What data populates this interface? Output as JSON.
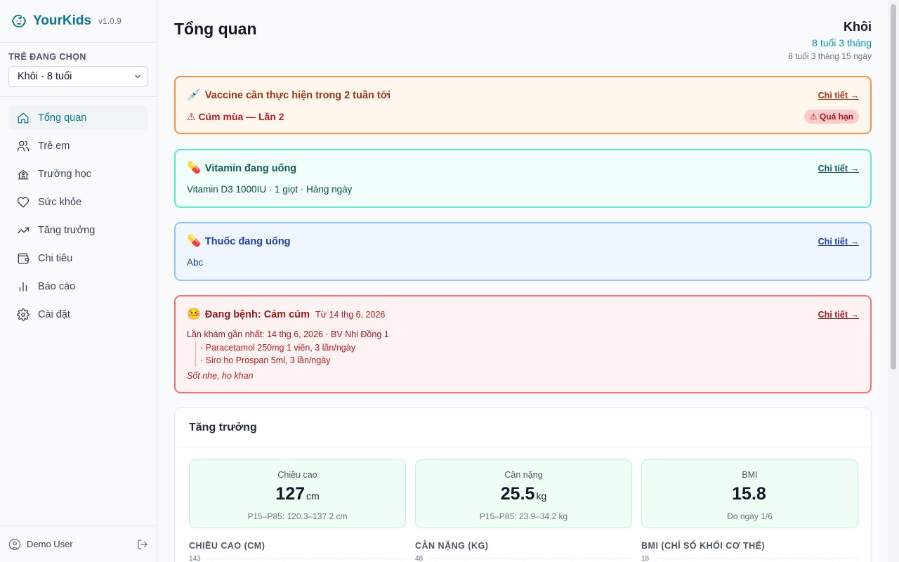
{
  "app": {
    "name": "YourKids",
    "version": "v1.0.9"
  },
  "sidebar": {
    "child_label": "TRẺ ĐANG CHỌN",
    "selected_child": "Khôi · 8 tuổi",
    "items": [
      {
        "label": "Tổng quan",
        "icon": "home-icon",
        "active": true
      },
      {
        "label": "Trẻ em",
        "icon": "users-icon"
      },
      {
        "label": "Trường học",
        "icon": "school-icon"
      },
      {
        "label": "Sức khỏe",
        "icon": "heart-icon"
      },
      {
        "label": "Tăng trưởng",
        "icon": "trending-up-icon"
      },
      {
        "label": "Chi tiêu",
        "icon": "wallet-icon"
      },
      {
        "label": "Báo cáo",
        "icon": "bar-chart-icon"
      },
      {
        "label": "Cài đặt",
        "icon": "gear-icon"
      }
    ],
    "user": "Demo User"
  },
  "header": {
    "title": "Tổng quan",
    "child_name": "Khôi",
    "child_age": "8 tuổi 3 tháng",
    "child_age_full": "8 tuổi 3 tháng 15 ngày"
  },
  "cards": {
    "vaccine": {
      "emoji": "💉",
      "title": "Vaccine cần thực hiện trong 2 tuần tới",
      "link": "Chi tiết →",
      "item": "⚠ Cúm mùa — Lần 2",
      "badge": "⚠ Quá hạn"
    },
    "vitamin": {
      "emoji": "💊",
      "title": "Vitamin đang uống",
      "link": "Chi tiết →",
      "body": "Vitamin D3 1000IU · 1 giọt · Hàng ngày"
    },
    "medicine": {
      "emoji": "💊",
      "title": "Thuốc đang uống",
      "link": "Chi tiết →",
      "body": "Abc"
    },
    "illness": {
      "emoji": "🤒",
      "title": "Đang bệnh: Cảm cúm",
      "since": "Từ 14 thg 6, 2026",
      "link": "Chi tiết →",
      "visit": "Lần khám gần nhất: 14 thg 6, 2026 · BV Nhi Đồng 1",
      "meds": [
        "· Paracetamol 250mg 1 viên, 3 lần/ngày",
        "· Siro ho Prospan 5ml, 3 lần/ngày"
      ],
      "note": "Sốt nhẹ, ho khan"
    }
  },
  "growth": {
    "title": "Tăng trưởng",
    "stats": [
      {
        "label": "Chiều cao",
        "value": "127",
        "unit": "cm",
        "sub": "P15–P85: 120.3–137.2 cm"
      },
      {
        "label": "Cân nặng",
        "value": "25.5",
        "unit": "kg",
        "sub": "P15–P85: 23.9–34.2 kg"
      },
      {
        "label": "BMI",
        "value": "15.8",
        "unit": "",
        "sub": "Đo ngày 1/6"
      }
    ],
    "charts": [
      {
        "label": "CHIỀU CAO (CM)",
        "top_tick": "143"
      },
      {
        "label": "CÂN NẶNG (KG)",
        "top_tick": "48"
      },
      {
        "label": "BMI (CHỈ SỐ KHỐI CƠ THỂ)",
        "top_tick": "18"
      }
    ]
  }
}
